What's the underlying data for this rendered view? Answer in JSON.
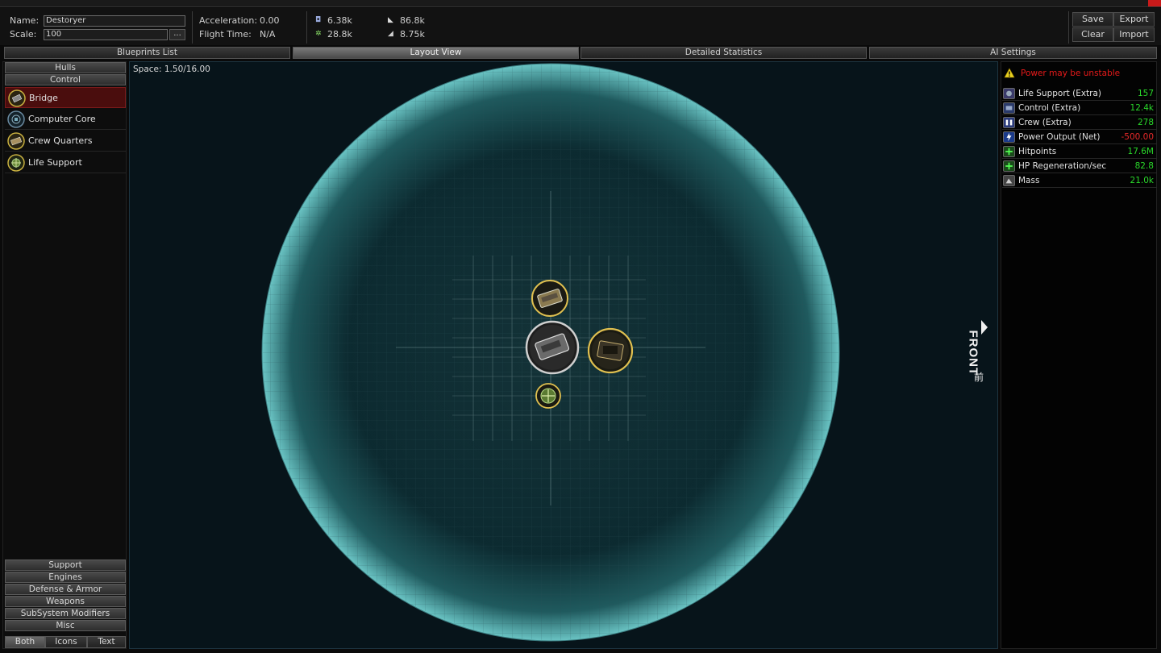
{
  "header": {
    "name_label": "Name:",
    "name_value": "Destoryer",
    "scale_label": "Scale:",
    "scale_value": "100",
    "scale_button": "...",
    "accel_label": "Acceleration:",
    "accel_value": "0.00",
    "flight_label": "Flight Time:",
    "flight_value": "N/A",
    "stats": [
      "6.38k",
      "86.8k",
      "28.8k",
      "8.75k"
    ],
    "save": "Save",
    "export": "Export",
    "clear": "Clear",
    "import": "Import"
  },
  "tabs": [
    "Blueprints List",
    "Layout View",
    "Detailed Statistics",
    "AI Settings"
  ],
  "left": {
    "hulls": "Hulls",
    "control": "Control",
    "components": [
      "Bridge",
      "Computer Core",
      "Crew Quarters",
      "Life Support"
    ],
    "categories": [
      "Support",
      "Engines",
      "Defense & Armor",
      "Weapons",
      "SubSystem Modifiers",
      "Misc"
    ],
    "view_modes": [
      "Both",
      "Icons",
      "Text"
    ]
  },
  "canvas": {
    "space": "Space: 1.50/16.00",
    "front": "FRONT",
    "front_cn": "前"
  },
  "right": {
    "warning": "Power may be unstable",
    "stats": [
      {
        "label": "Life Support (Extra)",
        "value": "157",
        "color": "#2ad82a"
      },
      {
        "label": "Control (Extra)",
        "value": "12.4k",
        "color": "#2ad82a"
      },
      {
        "label": "Crew (Extra)",
        "value": "278",
        "color": "#2ad82a"
      },
      {
        "label": "Power Output (Net)",
        "value": "-500.00",
        "color": "#e82a2a"
      },
      {
        "label": "Hitpoints",
        "value": "17.6M",
        "color": "#2ad82a"
      },
      {
        "label": "HP Regeneration/sec",
        "value": "82.8",
        "color": "#2ad82a"
      },
      {
        "label": "Mass",
        "value": "21.0k",
        "color": "#2ad82a"
      }
    ]
  },
  "colors": {
    "selected_row": "#4a0d0d",
    "bubble_rim": "#5fb8b8",
    "warning": "#e81a1a",
    "positive": "#2ad82a",
    "negative": "#e82a2a"
  }
}
